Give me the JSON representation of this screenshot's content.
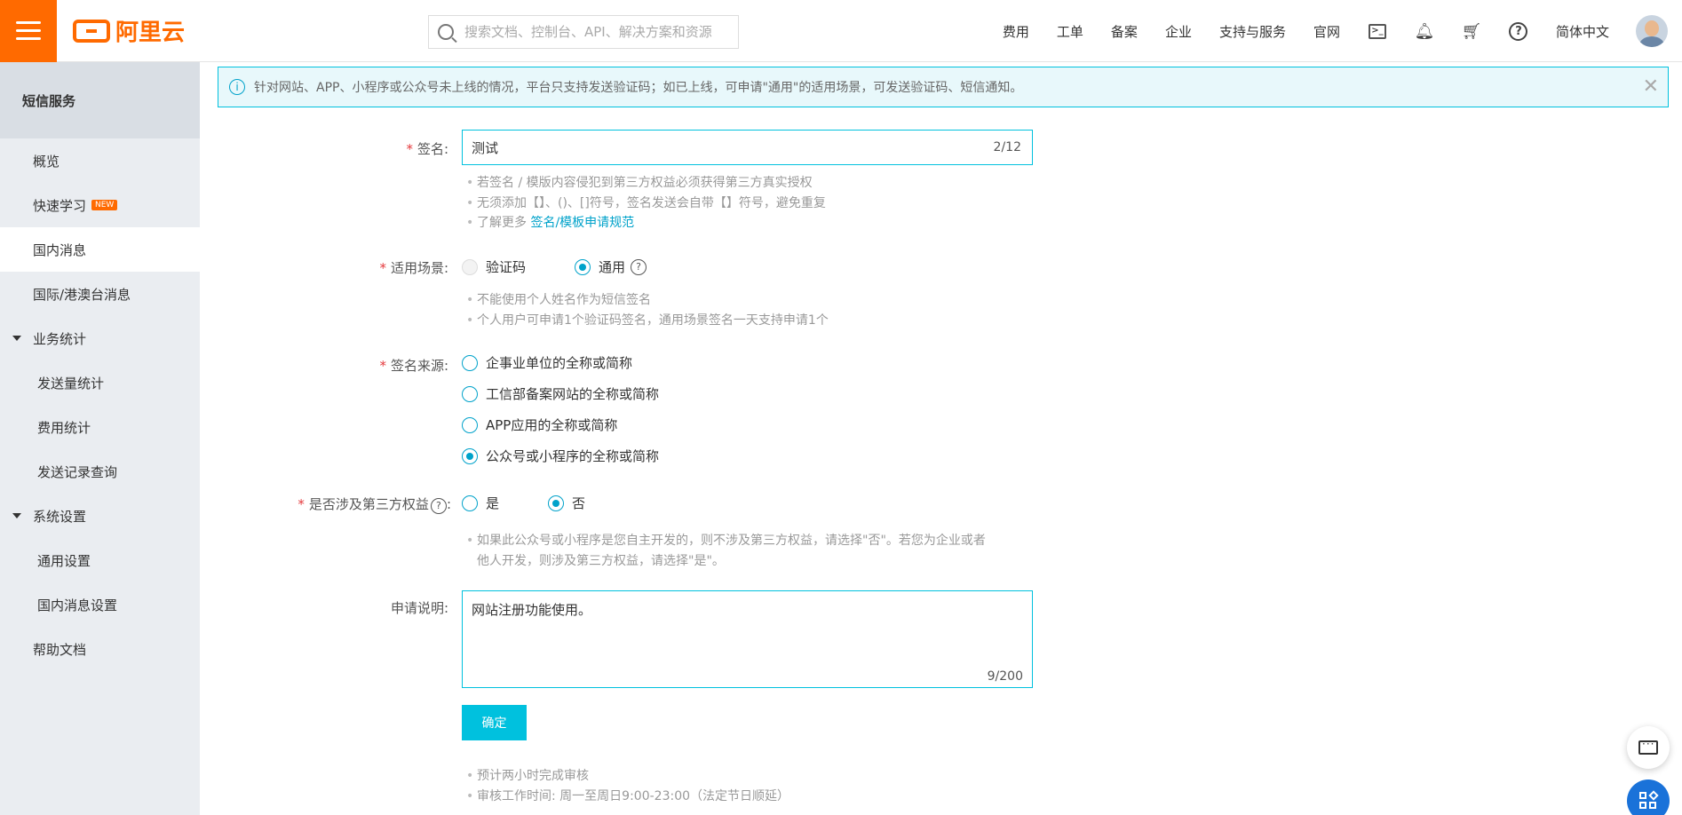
{
  "topbar": {
    "logo_text": "阿里云",
    "search_placeholder": "搜索文档、控制台、API、解决方案和资源",
    "nav": [
      "费用",
      "工单",
      "备案",
      "企业",
      "支持与服务",
      "官网"
    ],
    "language": "简体中文"
  },
  "sidebar": {
    "title": "短信服务",
    "items": [
      {
        "label": "概览"
      },
      {
        "label": "快速学习",
        "badge": "NEW"
      },
      {
        "label": "国内消息"
      },
      {
        "label": "国际/港澳台消息"
      },
      {
        "label": "业务统计"
      },
      {
        "label": "发送量统计"
      },
      {
        "label": "费用统计"
      },
      {
        "label": "发送记录查询"
      },
      {
        "label": "系统设置"
      },
      {
        "label": "通用设置"
      },
      {
        "label": "国内消息设置"
      },
      {
        "label": "帮助文档"
      }
    ]
  },
  "notice": {
    "text": "针对网站、APP、小程序或公众号未上线的情况，平台只支持发送验证码；如已上线，可申请\"通用\"的适用场景，可发送验证码、短信通知。"
  },
  "form": {
    "signature": {
      "label": "签名:",
      "value": "测试",
      "counter": "2/12",
      "hints": [
        "若签名 / 模版内容侵犯到第三方权益必须获得第三方真实授权",
        "无须添加【】、()、[]符号，签名发送会自带【】符号，避免重复"
      ],
      "hint_more_prefix": "了解更多",
      "hint_more_link": "签名/模板申请规范"
    },
    "scenario": {
      "label": "适用场景:",
      "options": [
        "验证码",
        "通用"
      ],
      "hints": [
        "不能使用个人姓名作为短信签名",
        "个人用户可申请1个验证码签名，通用场景签名一天支持申请1个"
      ]
    },
    "source": {
      "label": "签名来源:",
      "options": [
        "企事业单位的全称或简称",
        "工信部备案网站的全称或简称",
        "APP应用的全称或简称",
        "公众号或小程序的全称或简称"
      ]
    },
    "third_party": {
      "label": "是否涉及第三方权益",
      "label_suffix": ":",
      "options": [
        "是",
        "否"
      ],
      "hints": [
        "如果此公众号或小程序是您自主开发的，则不涉及第三方权益，请选择\"否\"。若您为企业或者",
        "他人开发，则涉及第三方权益，请选择\"是\"。"
      ]
    },
    "description": {
      "label": "申请说明:",
      "value": "网站注册功能使用。",
      "counter": "9/200"
    },
    "confirm_label": "确定",
    "footer_hints": [
      "预计两小时完成审核",
      "审核工作时间: 周一至周日9:00-23:00（法定节日顺延）"
    ]
  },
  "colors": {
    "brand": "#ff6a00",
    "accent": "#00c1de",
    "link": "#00a2ca"
  }
}
